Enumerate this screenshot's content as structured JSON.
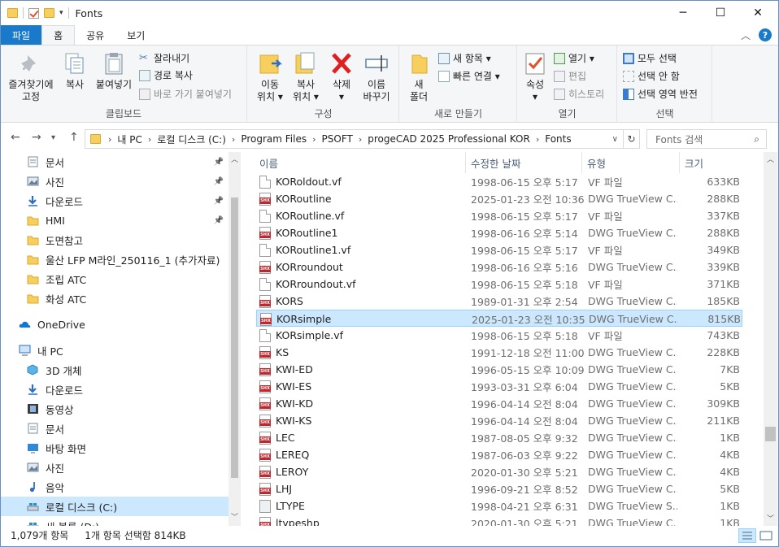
{
  "window": {
    "title": "Fonts"
  },
  "tabs": [
    "파일",
    "홈",
    "공유",
    "보기"
  ],
  "ribbon": {
    "clipboard": {
      "pin": "즐겨찾기에\n고정",
      "copy": "복사",
      "paste": "붙여넣기",
      "cut": "잘라내기",
      "copy_path": "경로 복사",
      "paste_shortcut": "바로 가기 붙여넣기",
      "label": "클립보드"
    },
    "organize": {
      "move": "이동\n위치 ▾",
      "copy_to": "복사\n위치 ▾",
      "delete": "삭제\n▾",
      "rename": "이름\n바꾸기",
      "label": "구성"
    },
    "new": {
      "folder": "새\n폴더",
      "new_item": "새 항목 ▾",
      "easy_access": "빠른 연결 ▾",
      "label": "새로 만들기"
    },
    "open": {
      "properties": "속성\n▾",
      "open": "열기 ▾",
      "edit": "편집",
      "history": "히스토리",
      "label": "열기"
    },
    "select": {
      "all": "모두 선택",
      "none": "선택 안 함",
      "invert": "선택 영역 반전",
      "label": "선택"
    }
  },
  "address": {
    "crumbs": [
      "내 PC",
      "로컬 디스크 (C:)",
      "Program Files",
      "PSOFT",
      "progeCAD 2025 Professional KOR",
      "Fonts"
    ],
    "search_placeholder": "Fonts 검색"
  },
  "nav": {
    "quick": [
      {
        "label": "문서",
        "icon": "documents-icon",
        "pinned": true
      },
      {
        "label": "사진",
        "icon": "pictures-icon",
        "pinned": true
      },
      {
        "label": "다운로드",
        "icon": "download-icon",
        "pinned": true
      },
      {
        "label": "HMI",
        "icon": "folder-icon",
        "pinned": true
      },
      {
        "label": "도면참고",
        "icon": "folder-icon",
        "pinned": false
      },
      {
        "label": "울산 LFP M라인_250116_1 (추가자료)",
        "icon": "folder-icon",
        "pinned": false
      },
      {
        "label": "조립 ATC",
        "icon": "folder-icon",
        "pinned": false
      },
      {
        "label": "화성 ATC",
        "icon": "folder-icon",
        "pinned": false
      }
    ],
    "onedrive": "OneDrive",
    "thispc": "내 PC",
    "pc_items": [
      {
        "label": "3D 개체",
        "icon": "3d-objects-icon"
      },
      {
        "label": "다운로드",
        "icon": "download-icon"
      },
      {
        "label": "동영상",
        "icon": "videos-icon"
      },
      {
        "label": "문서",
        "icon": "documents-icon"
      },
      {
        "label": "바탕 화면",
        "icon": "desktop-icon"
      },
      {
        "label": "사진",
        "icon": "pictures-icon"
      },
      {
        "label": "음악",
        "icon": "music-icon"
      },
      {
        "label": "로컬 디스크 (C:)",
        "icon": "drive-icon"
      },
      {
        "label": "새 볼륨 (D:)",
        "icon": "drive-icon"
      }
    ]
  },
  "columns": {
    "name": "이름",
    "date": "수정한 날짜",
    "type": "유형",
    "size": "크기"
  },
  "files": [
    {
      "name": "KORoldout.vf",
      "date": "1998-06-15 오후 5:17",
      "type": "VF 파일",
      "size": "633KB",
      "icon": "vf"
    },
    {
      "name": "KORoutline",
      "date": "2025-01-23 오전 10:36",
      "type": "DWG TrueView C...",
      "size": "288KB",
      "icon": "shx"
    },
    {
      "name": "KORoutline.vf",
      "date": "1998-06-15 오후 5:17",
      "type": "VF 파일",
      "size": "337KB",
      "icon": "vf"
    },
    {
      "name": "KORoutline1",
      "date": "1998-06-16 오후 5:14",
      "type": "DWG TrueView C...",
      "size": "288KB",
      "icon": "shx"
    },
    {
      "name": "KORoutline1.vf",
      "date": "1998-06-15 오후 5:17",
      "type": "VF 파일",
      "size": "349KB",
      "icon": "vf"
    },
    {
      "name": "KORroundout",
      "date": "1998-06-16 오후 5:16",
      "type": "DWG TrueView C...",
      "size": "339KB",
      "icon": "shx"
    },
    {
      "name": "KORroundout.vf",
      "date": "1998-06-15 오후 5:18",
      "type": "VF 파일",
      "size": "371KB",
      "icon": "vf"
    },
    {
      "name": "KORS",
      "date": "1989-01-31 오후 2:54",
      "type": "DWG TrueView C...",
      "size": "185KB",
      "icon": "shx"
    },
    {
      "name": "KORsimple",
      "date": "2025-01-23 오전 10:35",
      "type": "DWG TrueView C...",
      "size": "815KB",
      "icon": "shx",
      "selected": true
    },
    {
      "name": "KORsimple.vf",
      "date": "1998-06-15 오후 5:18",
      "type": "VF 파일",
      "size": "743KB",
      "icon": "vf"
    },
    {
      "name": "KS",
      "date": "1991-12-18 오전 11:00",
      "type": "DWG TrueView C...",
      "size": "228KB",
      "icon": "shx"
    },
    {
      "name": "KWI-ED",
      "date": "1996-05-15 오후 10:09",
      "type": "DWG TrueView C...",
      "size": "7KB",
      "icon": "shx"
    },
    {
      "name": "KWI-ES",
      "date": "1993-03-31 오후 6:04",
      "type": "DWG TrueView C...",
      "size": "5KB",
      "icon": "shx"
    },
    {
      "name": "KWI-KD",
      "date": "1996-04-14 오전 8:04",
      "type": "DWG TrueView C...",
      "size": "309KB",
      "icon": "shx"
    },
    {
      "name": "KWI-KS",
      "date": "1996-04-14 오전 8:04",
      "type": "DWG TrueView C...",
      "size": "211KB",
      "icon": "shx"
    },
    {
      "name": "LEC",
      "date": "1987-08-05 오후 9:32",
      "type": "DWG TrueView C...",
      "size": "1KB",
      "icon": "shx"
    },
    {
      "name": "LEREQ",
      "date": "1987-06-03 오후 9:22",
      "type": "DWG TrueView C...",
      "size": "4KB",
      "icon": "shx"
    },
    {
      "name": "LEROY",
      "date": "2020-01-30 오후 5:21",
      "type": "DWG TrueView C...",
      "size": "4KB",
      "icon": "shx"
    },
    {
      "name": "LHJ",
      "date": "1996-09-21 오후 8:52",
      "type": "DWG TrueView C...",
      "size": "5KB",
      "icon": "shx"
    },
    {
      "name": "LTYPE",
      "date": "1998-04-21 오후 6:31",
      "type": "DWG TrueView S...",
      "size": "1KB",
      "icon": "ltype"
    },
    {
      "name": "ltypeshp",
      "date": "2020-01-30 오후 5:21",
      "type": "DWG TrueView C...",
      "size": "1KB",
      "icon": "shx"
    }
  ],
  "status": {
    "count": "1,079개 항목",
    "selection": "1개 항목 선택함 814KB"
  }
}
